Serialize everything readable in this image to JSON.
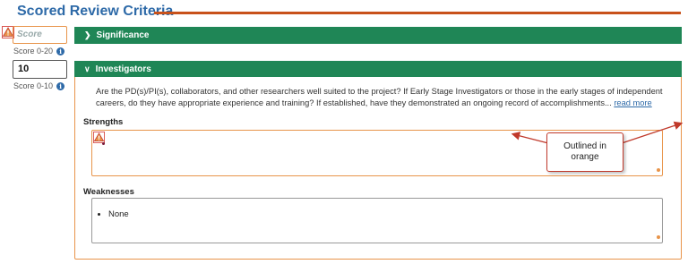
{
  "page": {
    "title": "Scored Review Criteria"
  },
  "scores": [
    {
      "placeholder": "Score",
      "value": "",
      "range": "Score 0-20"
    },
    {
      "placeholder": "",
      "value": "10",
      "range": "Score 0-10"
    }
  ],
  "sections": {
    "significance": {
      "label": "Significance",
      "expanded": false
    },
    "investigators": {
      "label": "Investigators",
      "expanded": true,
      "question": "Are the PD(s)/PI(s), collaborators, and other researchers well suited to the project? If Early Stage Investigators or those in the early stages of independent careers, do they have appropriate experience and training? If established, have they demonstrated an ongoing record of accomplishments...",
      "read_more": "read more",
      "strengths_label": "Strengths",
      "strengths_value": "",
      "weaknesses_label": "Weaknesses",
      "weaknesses_items": [
        "None"
      ]
    }
  },
  "annotation": {
    "callout_text": "Outlined in orange",
    "color": "#c0392b"
  },
  "colors": {
    "accent_green": "#1f8656",
    "title_blue": "#2e6aa8",
    "warning_orange": "#e8944a",
    "rule": "#c8511a"
  },
  "icons": [
    "warning-icon",
    "info-icon",
    "chevron-right-icon",
    "chevron-down-icon"
  ]
}
